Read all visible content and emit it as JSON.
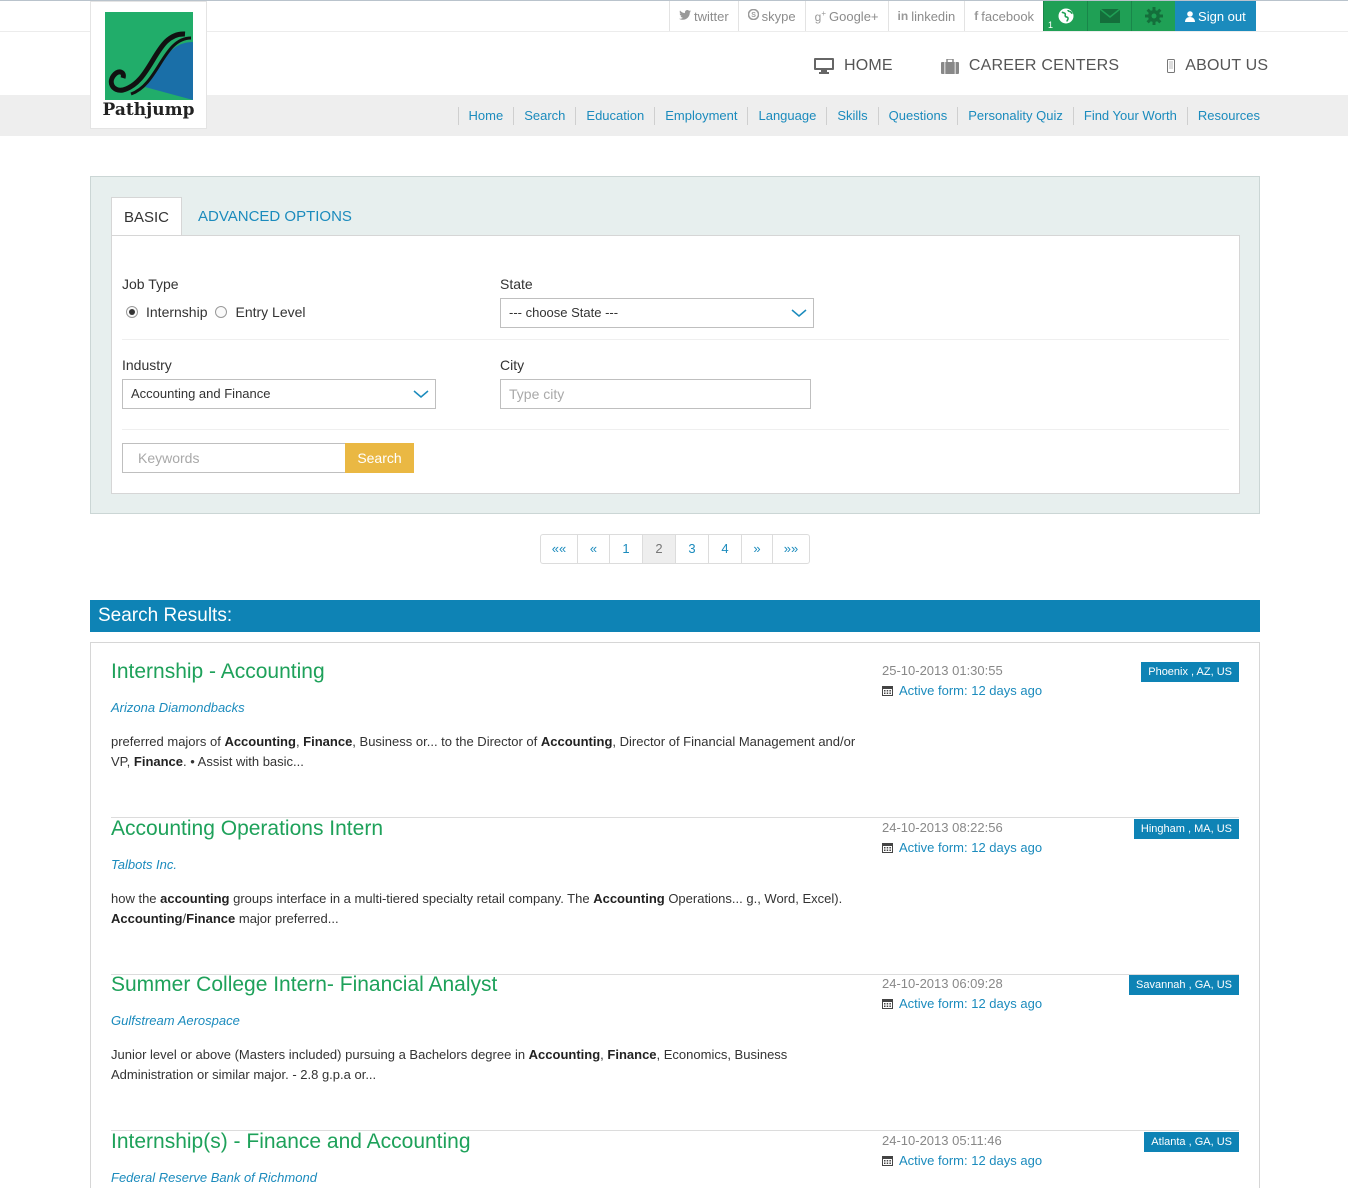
{
  "topbar": {
    "social": [
      {
        "icon": "twitter-icon",
        "glyph": "🐦",
        "label": "twitter"
      },
      {
        "icon": "skype-icon",
        "glyph": "S",
        "label": "skype"
      },
      {
        "icon": "google-plus-icon",
        "glyph": "g+",
        "label": "Google+"
      },
      {
        "icon": "linkedin-icon",
        "glyph": "in",
        "label": "linkedin"
      },
      {
        "icon": "facebook-icon",
        "glyph": "f",
        "label": "facebook"
      }
    ],
    "notification_count": "1",
    "signout_label": "Sign out"
  },
  "logo": {
    "brand": "Pathjump"
  },
  "mainnav": [
    {
      "label": "HOME",
      "icon": "monitor-icon"
    },
    {
      "label": "CAREER CENTERS",
      "icon": "briefcase-icon"
    },
    {
      "label": "ABOUT US",
      "icon": "mobile-icon"
    }
  ],
  "subnav": [
    "Home",
    "Search",
    "Education",
    "Employment",
    "Language",
    "Skills",
    "Questions",
    "Personality Quiz",
    "Find Your Worth",
    "Resources"
  ],
  "search": {
    "tab_basic": "BASIC",
    "tab_advanced": "ADVANCED OPTIONS",
    "job_type_label": "Job Type",
    "radio_internship": "Internship",
    "radio_entry": "Entry Level",
    "state_label": "State",
    "state_value": "--- choose State ---",
    "industry_label": "Industry",
    "industry_value": "Accounting and Finance",
    "city_label": "City",
    "city_placeholder": "Type city",
    "keywords_placeholder": "Keywords",
    "search_button": "Search"
  },
  "pagination": [
    "««",
    "«",
    "1",
    "2",
    "3",
    "4",
    "»",
    "»»"
  ],
  "pagination_current": "2",
  "results": {
    "heading": "Search Results:",
    "jobs": [
      {
        "title": "Internship - Accounting",
        "company": "Arizona Diamondbacks",
        "desc_html": "preferred majors of <b>Accounting</b>, <b>Finance</b>, Business or... to the Director of <b>Accounting</b>, Director of Financial Management and/or VP, <b>Finance</b>. • Assist with basic...",
        "date": "25-10-2013 01:30:55",
        "active": "Active form: 12 days ago",
        "location": "Phoenix , AZ, US"
      },
      {
        "title": "Accounting Operations Intern",
        "company": "Talbots Inc.",
        "desc_html": "how the <b>accounting</b> groups interface in a multi-tiered specialty retail company. The <b>Accounting</b> Operations... g., Word, Excel). <b>Accounting</b>/<b>Finance</b> major preferred...",
        "date": "24-10-2013 08:22:56",
        "active": "Active form: 12 days ago",
        "location": "Hingham , MA, US"
      },
      {
        "title": "Summer College Intern- Financial Analyst",
        "company": "Gulfstream Aerospace",
        "desc_html": "Junior level or above (Masters included) pursuing a Bachelors degree in <b>Accounting</b>, <b>Finance</b>, Economics, Business Administration or similar major. - 2.8 g.p.a or...",
        "date": "24-10-2013 06:09:28",
        "active": "Active form: 12 days ago",
        "location": "Savannah , GA, US"
      },
      {
        "title": "Internship(s) - Finance and Accounting",
        "company": "Federal Reserve Bank of Richmond",
        "desc_html": "",
        "date": "24-10-2013 05:11:46",
        "active": "Active form: 12 days ago",
        "location": "Atlanta , GA, US"
      }
    ]
  },
  "colors": {
    "green": "#1ea15a",
    "blue": "#1b8bbd",
    "header_blue": "#0e83b5",
    "search_yellow": "#eab843"
  }
}
